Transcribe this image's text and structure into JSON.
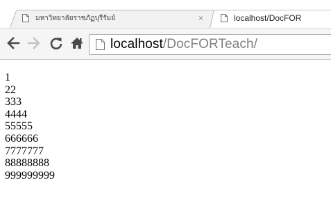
{
  "tabs": [
    {
      "title": "มหาวิทยาลัยราชภัฏบุรีรัมย์",
      "close": "×",
      "active": false
    },
    {
      "title": "localhost/DocFOR",
      "active": true
    }
  ],
  "toolbar": {
    "icons": [
      "back-arrow-icon",
      "forward-arrow-icon",
      "reload-icon",
      "home-icon",
      "page-icon"
    ],
    "url_host": "localhost",
    "url_path": "/DocFORTeach/"
  },
  "content": {
    "lines": [
      "1",
      "22",
      "333",
      "4444",
      "55555",
      "666666",
      "7777777",
      "88888888",
      "999999999"
    ]
  }
}
